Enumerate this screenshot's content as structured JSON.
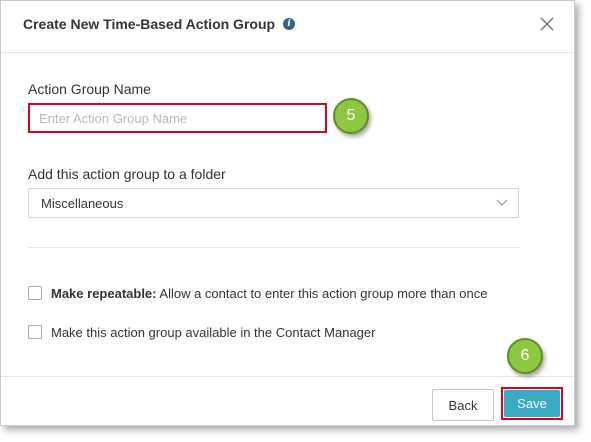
{
  "dialog": {
    "title": "Create New Time-Based Action Group",
    "info_icon_glyph": "i",
    "close_icon": "close-icon"
  },
  "form": {
    "name_label": "Action Group Name",
    "name_placeholder": "Enter Action Group Name",
    "name_value": "",
    "folder_label": "Add this action group to a folder",
    "folder_selected": "Miscellaneous",
    "repeatable_bold": "Make repeatable:",
    "repeatable_text": " Allow a contact to enter this action group more than once",
    "repeatable_checked": false,
    "contact_manager_text": "Make this action group available in the Contact Manager",
    "contact_manager_checked": false
  },
  "footer": {
    "back_label": "Back",
    "save_label": "Save"
  },
  "annotations": {
    "step_5": "5",
    "step_6": "6"
  },
  "colors": {
    "highlight_red": "#e0001b",
    "badge_green": "#8dc63f",
    "save_blue": "#39a9c6",
    "info_blue": "#34618f"
  }
}
